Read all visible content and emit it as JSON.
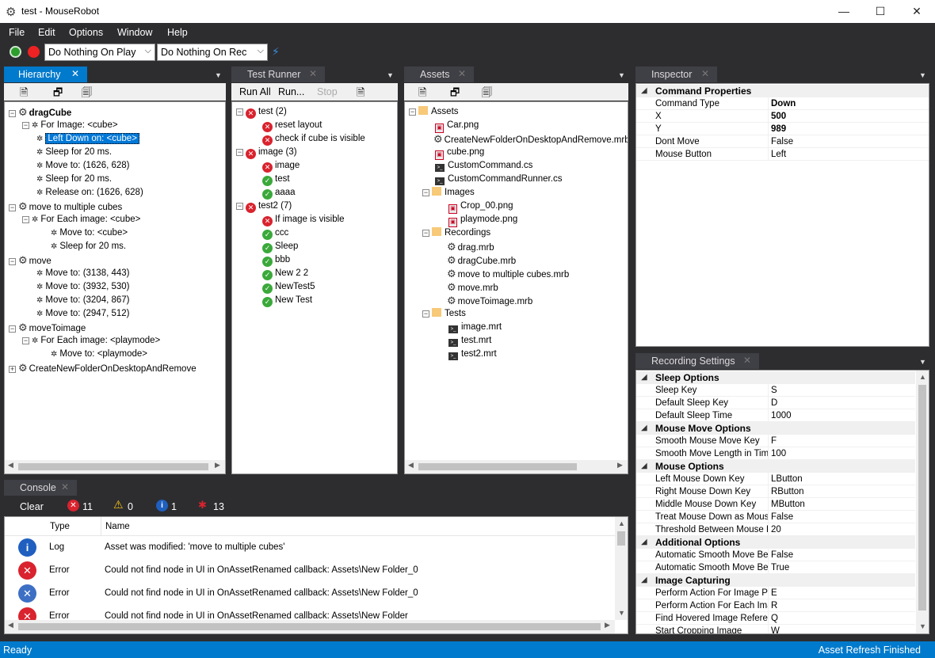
{
  "window": {
    "title": "test - MouseRobot",
    "minimize": "—",
    "maximize": "☐",
    "close": "✕"
  },
  "menu": [
    "File",
    "Edit",
    "Options",
    "Window",
    "Help"
  ],
  "toolbar": {
    "play_mode": "Do Nothing On Play",
    "rec_mode": "Do Nothing On Rec"
  },
  "hierarchy": {
    "tab": "Hierarchy",
    "items": [
      {
        "text": "dragCube",
        "kind": "script",
        "bold": true
      },
      {
        "text": "For Image: <cube>",
        "kind": "cmd"
      },
      {
        "text": "Left Down on: <cube>",
        "kind": "cmd",
        "selected": true
      },
      {
        "text": "Sleep for 20 ms.",
        "kind": "cmd"
      },
      {
        "text": "Move to: (1626, 628)",
        "kind": "cmd"
      },
      {
        "text": "Sleep for 20 ms.",
        "kind": "cmd"
      },
      {
        "text": "Release on: (1626, 628)",
        "kind": "cmd"
      },
      {
        "text": "move to multiple cubes",
        "kind": "script"
      },
      {
        "text": "For Each image: <cube>",
        "kind": "cmd"
      },
      {
        "text": "Move to: <cube>",
        "kind": "cmd"
      },
      {
        "text": "Sleep for 20 ms.",
        "kind": "cmd"
      },
      {
        "text": "move",
        "kind": "script"
      },
      {
        "text": "Move to: (3138, 443)",
        "kind": "cmd"
      },
      {
        "text": "Move to: (3932, 530)",
        "kind": "cmd"
      },
      {
        "text": "Move to: (3204, 867)",
        "kind": "cmd"
      },
      {
        "text": "Move to: (2947, 512)",
        "kind": "cmd"
      },
      {
        "text": "moveToimage",
        "kind": "script"
      },
      {
        "text": "For Each image: <playmode>",
        "kind": "cmd"
      },
      {
        "text": "Move to: <playmode>",
        "kind": "cmd"
      },
      {
        "text": "CreateNewFolderOnDesktopAndRemove",
        "kind": "script"
      }
    ]
  },
  "test_runner": {
    "tab": "Test Runner",
    "run_all": "Run All",
    "run": "Run...",
    "stop": "Stop",
    "items": [
      {
        "text": "test (2)",
        "status": "error"
      },
      {
        "text": "reset layout",
        "status": "error"
      },
      {
        "text": "check if cube is visible",
        "status": "error"
      },
      {
        "text": "image (3)",
        "status": "error"
      },
      {
        "text": "image",
        "status": "error"
      },
      {
        "text": "test",
        "status": "ok"
      },
      {
        "text": "aaaa",
        "status": "ok"
      },
      {
        "text": "test2 (7)",
        "status": "error"
      },
      {
        "text": "If image is visible",
        "status": "error"
      },
      {
        "text": "ccc",
        "status": "ok"
      },
      {
        "text": "Sleep",
        "status": "ok"
      },
      {
        "text": "bbb",
        "status": "ok"
      },
      {
        "text": "New 2 2",
        "status": "ok"
      },
      {
        "text": "NewTest5",
        "status": "ok"
      },
      {
        "text": "New Test",
        "status": "ok"
      }
    ]
  },
  "assets": {
    "tab": "Assets",
    "items": [
      {
        "text": "Assets",
        "kind": "folder"
      },
      {
        "text": "Car.png",
        "kind": "png"
      },
      {
        "text": "CreateNewFolderOnDesktopAndRemove.mrb",
        "kind": "script"
      },
      {
        "text": "cube.png",
        "kind": "png"
      },
      {
        "text": "CustomCommand.cs",
        "kind": "cs"
      },
      {
        "text": "CustomCommandRunner.cs",
        "kind": "cs"
      },
      {
        "text": "Images",
        "kind": "folder"
      },
      {
        "text": "Crop_00.png",
        "kind": "png"
      },
      {
        "text": "playmode.png",
        "kind": "png"
      },
      {
        "text": "Recordings",
        "kind": "folder"
      },
      {
        "text": "drag.mrb",
        "kind": "script"
      },
      {
        "text": "dragCube.mrb",
        "kind": "script"
      },
      {
        "text": "move to multiple cubes.mrb",
        "kind": "script"
      },
      {
        "text": "move.mrb",
        "kind": "script"
      },
      {
        "text": "moveToimage.mrb",
        "kind": "script"
      },
      {
        "text": "Tests",
        "kind": "folder"
      },
      {
        "text": "image.mrt",
        "kind": "cs"
      },
      {
        "text": "test.mrt",
        "kind": "cs"
      },
      {
        "text": "test2.mrt",
        "kind": "cs"
      }
    ]
  },
  "inspector": {
    "tab": "Inspector",
    "category": "Command Properties",
    "props": [
      {
        "name": "Command Type",
        "value": "Down",
        "bold": true
      },
      {
        "name": "X",
        "value": "500",
        "bold": true
      },
      {
        "name": "Y",
        "value": "989",
        "bold": true
      },
      {
        "name": "Dont Move",
        "value": "False"
      },
      {
        "name": "Mouse Button",
        "value": "Left"
      }
    ]
  },
  "recording_settings": {
    "tab": "Recording Settings",
    "groups": [
      {
        "name": "Sleep Options",
        "props": [
          {
            "name": "Sleep Key",
            "value": "S"
          },
          {
            "name": "Default Sleep Key",
            "value": "D"
          },
          {
            "name": "Default Sleep Time",
            "value": "1000"
          }
        ]
      },
      {
        "name": "Mouse Move Options",
        "props": [
          {
            "name": "Smooth Mouse Move Key",
            "value": "F"
          },
          {
            "name": "Smooth Move Length in Time",
            "value": "100"
          }
        ]
      },
      {
        "name": "Mouse Options",
        "props": [
          {
            "name": "Left Mouse Down Key",
            "value": "LButton"
          },
          {
            "name": "Right Mouse Down Key",
            "value": "RButton"
          },
          {
            "name": "Middle Mouse Down Key",
            "value": "MButton"
          },
          {
            "name": "Treat Mouse Down as Mouse",
            "value": "False"
          },
          {
            "name": "Threshold Between Mouse D",
            "value": "20"
          }
        ]
      },
      {
        "name": "Additional Options",
        "props": [
          {
            "name": "Automatic Smooth Move Befc",
            "value": "False"
          },
          {
            "name": "Automatic Smooth Move Befc",
            "value": "True"
          }
        ]
      },
      {
        "name": "Image Capturing",
        "props": [
          {
            "name": "Perform Action For Image Pc",
            "value": "E"
          },
          {
            "name": "Perform Action For Each Ima",
            "value": "R"
          },
          {
            "name": "Find Hovered Image Referen",
            "value": "Q"
          },
          {
            "name": "Start Cropping Image",
            "value": "W"
          }
        ]
      }
    ]
  },
  "console": {
    "tab": "Console",
    "clear": "Clear",
    "error_count": "11",
    "warning_count": "0",
    "info_count": "1",
    "bug_count": "13",
    "col_type": "Type",
    "col_name": "Name",
    "rows": [
      {
        "type": "Log",
        "name": "Asset was modified: 'move to multiple cubes'",
        "icon": "info"
      },
      {
        "type": "Error",
        "name": "Could not find node in UI in OnAssetRenamed callback: Assets\\New Folder_0",
        "icon": "error"
      },
      {
        "type": "Error",
        "name": "Could not find node in UI in OnAssetRenamed callback: Assets\\New Folder_0",
        "icon": "error-blue"
      },
      {
        "type": "Error",
        "name": "Could not find node in UI in OnAssetRenamed callback: Assets\\New Folder",
        "icon": "error"
      }
    ]
  },
  "status": {
    "left": "Ready",
    "right": "Asset Refresh Finished"
  },
  "colors": {
    "accent": "#007acc",
    "chrome": "#2d2d30",
    "error": "#d9232e",
    "ok": "#3aa93a",
    "info": "#1f5fbf"
  }
}
